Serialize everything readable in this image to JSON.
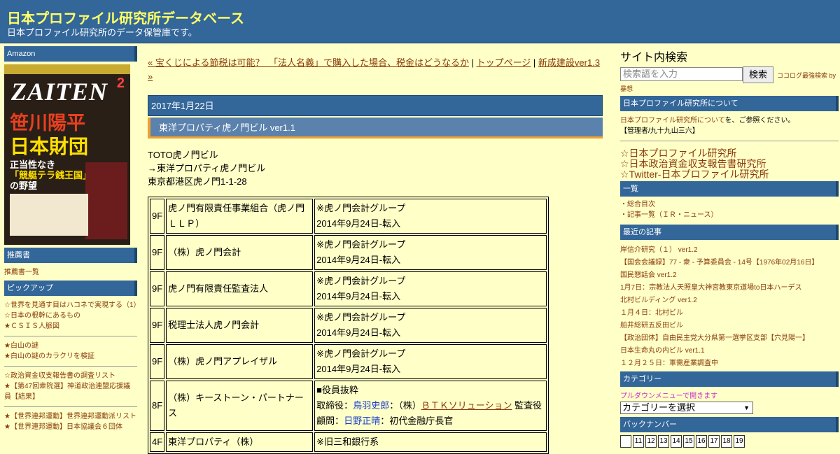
{
  "header": {
    "title": "日本プロファイル研究所データベース",
    "description": "日本プロファイル研究所のデータ保管庫です。"
  },
  "left": {
    "amazon_heading": "Amazon",
    "book": {
      "name": "ZAITEN",
      "issue": "2",
      "line1": "笹川陽平",
      "line2": "日本財団",
      "line3a": "正当性なき",
      "line3b": "「競艇テラ銭王国」",
      "line3c": "の野望"
    },
    "recommend_heading": "推薦書",
    "recommend_link": "推薦書一覧",
    "pickup_heading": "ピックアップ",
    "pickup_groups": [
      [
        "☆世界を見通す目はハコネで実現する（1）",
        "☆日本の根幹にあるもの",
        "★ＣＳＩＳ人脈図"
      ],
      [
        "★白山の謎",
        "★白山の謎のカラクリを検証"
      ],
      [
        "☆政治資金収支報告書の調査リスト",
        "★【第47回衆院選】神道政治連盟応援議員【結果】"
      ],
      [
        "★【世界連邦運動】世界連邦運動派リスト",
        "★【世界連邦運動】日本協議会６団体"
      ]
    ]
  },
  "main": {
    "nav": {
      "prev": "« 宝くじによる節税は可能？　「法人名義」で購入した場合、税金はどうなるか",
      "sep1": " | ",
      "top": "トップページ",
      "sep2": " | ",
      "next": "新成建設ver1.3 »"
    },
    "date": "2017年1月22日",
    "post_title": "東洋プロパティ虎ノ門ビル ver1.1",
    "body_lines": [
      "TOTO虎ノ門ビル",
      "→東洋プロパティ虎ノ門ビル",
      "東京都港区虎ノ門1-1-28"
    ],
    "tenants": [
      {
        "floor": "9F",
        "name": "虎ノ門有限責任事業組合（虎ノ門ＬＬＰ）",
        "note1": "※虎ノ門会計グループ",
        "note2": "2014年9月24日-転入"
      },
      {
        "floor": "9F",
        "name": "（株）虎ノ門会計",
        "note1": "※虎ノ門会計グループ",
        "note2": "2014年9月24日-転入"
      },
      {
        "floor": "9F",
        "name": "虎ノ門有限責任監査法人",
        "note1": "※虎ノ門会計グループ",
        "note2": "2014年9月24日-転入"
      },
      {
        "floor": "9F",
        "name": "税理士法人虎ノ門会計",
        "note1": "※虎ノ門会計グループ",
        "note2": "2014年9月24日-転入"
      },
      {
        "floor": "9F",
        "name": "（株）虎ノ門アプレイザル",
        "note1": "※虎ノ門会計グループ",
        "note2": "2014年9月24日-転入"
      }
    ],
    "keystone": {
      "floor": "8F",
      "name": "（株）キーストーン・パートナース",
      "l1": "■役員抜粋",
      "l2a": "取締役：",
      "l2b": "鳥羽史郎",
      "l2c": "：（株）",
      "l2d": "ＢＴＫソリューション",
      "l2e": " 監査役",
      "l3a": "顧問：",
      "l3b": "日野正晴",
      "l3c": "：初代金融庁長官"
    },
    "last_row": {
      "floor": "4F",
      "name": "東洋プロパティ（株）",
      "note1": "※旧三和銀行系"
    }
  },
  "right": {
    "search_title": "サイト内検索",
    "search_placeholder": "検索語を入力",
    "search_button": "検索",
    "search_note": "ココログ最強検索 by",
    "search_thought": "暴想",
    "about_heading": "日本プロファイル研究所について",
    "about_link": "日本プロファイル研究所について",
    "about_text": "を、ご参照ください。",
    "admin": "【管理者/九十九山三六】",
    "big_links": [
      "☆日本プロファイル研究所",
      "☆日本政治資金収支報告書研究所",
      "☆Twitter-日本プロファイル研究所"
    ],
    "list_heading": "一覧",
    "list_items": [
      "・総合目次",
      "・記事一覧（ＩＲ・ニュース）"
    ],
    "recent_heading": "最近の記事",
    "recent": [
      "岸信介研究（１） ver1.2",
      "【国会会議録】77 - 衆 - 予算委員会 - 14号【1976年02月16日】",
      "国民懇話会 ver1.2",
      "1月7日：宗教法人天照皇大神宮教東京道場to日本ハーデス",
      "北村ビルディング ver1.2",
      "１月４日：北村ビル",
      "船井総研五反田ビル",
      "【政治団体】自由民主党大分県第一選挙区支部【穴見陽一】",
      "日本生命丸の内ビル ver1.1",
      "１２月２５日：軍需産業調査中"
    ],
    "category_heading": "カテゴリー",
    "category_note": "プルダウンメニューで開きます",
    "category_select": "カテゴリーを選択",
    "backnumber_heading": "バックナンバー",
    "backnumbers": [
      "",
      "11",
      "12",
      "13",
      "14",
      "15",
      "16",
      "17",
      "18",
      "19"
    ]
  }
}
